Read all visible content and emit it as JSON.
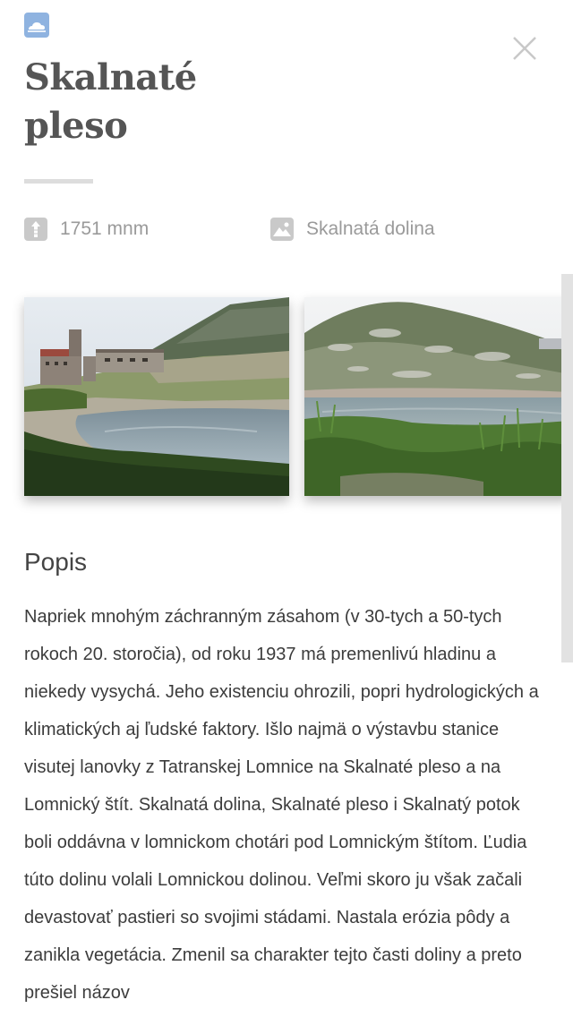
{
  "header": {
    "app_icon": "cloud-icon",
    "close_icon": "close-icon",
    "title_line1": "Skalnaté",
    "title_line2": "pleso"
  },
  "meta": {
    "altitude": {
      "icon": "altitude-icon",
      "text": "1751 mnm"
    },
    "location": {
      "icon": "landscape-icon",
      "text": "Skalnatá dolina"
    }
  },
  "gallery": {
    "photos": [
      {
        "name": "photo-chata-pri-plese"
      },
      {
        "name": "photo-pleso-svah"
      }
    ]
  },
  "description": {
    "heading": "Popis",
    "text": "Napriek mnohým záchranným zásahom (v 30-tych a 50-tych rokoch 20. storočia), od roku 1937 má premenlivú hladinu a niekedy vysychá. Jeho existenciu ohrozili, popri hydrologických a klimatických aj ľudské faktory. Išlo najmä o výstavbu stanice visutej lanovky z Tatranskej Lomnice na Skalnaté pleso a na Lomnický štít. Skalnatá dolina, Skalnaté pleso i Skalnatý potok boli oddávna v lomnickom chotári pod Lomnickým štítom. Ľudia túto dolinu volali Lomnickou dolinou. Veľmi skoro ju však začali devastovať pastieri so svojimi stádami. Nastala erózia pôdy a zanikla vegetácia. Zmenil sa charakter tejto časti doliny a preto prešiel názov"
  },
  "colors": {
    "icon_blue": "#8fb3e0",
    "meta_gray": "#9a9a9a",
    "divider": "#dddddd"
  }
}
